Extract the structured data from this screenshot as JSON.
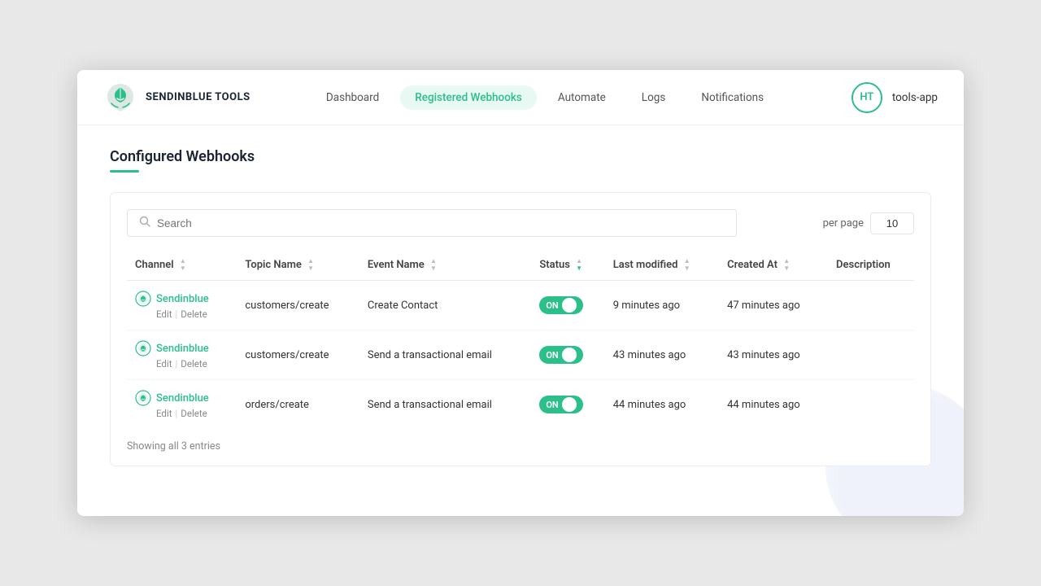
{
  "app": {
    "title": "SENDINBLUE TOOLS",
    "avatar_initials": "HT",
    "app_name": "tools-app"
  },
  "nav": {
    "items": [
      {
        "id": "dashboard",
        "label": "Dashboard",
        "active": false
      },
      {
        "id": "registered-webhooks",
        "label": "Registered Webhooks",
        "active": true
      },
      {
        "id": "automate",
        "label": "Automate",
        "active": false
      },
      {
        "id": "logs",
        "label": "Logs",
        "active": false
      },
      {
        "id": "notifications",
        "label": "Notifications",
        "active": false
      }
    ]
  },
  "page": {
    "title": "Configured Webhooks"
  },
  "search": {
    "placeholder": "Search",
    "value": ""
  },
  "pagination": {
    "per_page_label": "per page",
    "per_page_value": "10"
  },
  "table": {
    "columns": [
      {
        "id": "channel",
        "label": "Channel",
        "sortable": true,
        "sort_active": false
      },
      {
        "id": "topic_name",
        "label": "Topic Name",
        "sortable": true,
        "sort_active": false
      },
      {
        "id": "event_name",
        "label": "Event Name",
        "sortable": true,
        "sort_active": false
      },
      {
        "id": "status",
        "label": "Status",
        "sortable": true,
        "sort_active": true
      },
      {
        "id": "last_modified",
        "label": "Last modified",
        "sortable": true,
        "sort_active": false
      },
      {
        "id": "created_at",
        "label": "Created At",
        "sortable": true,
        "sort_active": false
      },
      {
        "id": "description",
        "label": "Description",
        "sortable": false,
        "sort_active": false
      }
    ],
    "rows": [
      {
        "channel": "Sendinblue",
        "topic_name": "customers/create",
        "event_name": "Create Contact",
        "status": "ON",
        "last_modified": "9 minutes ago",
        "created_at": "47 minutes ago",
        "description": ""
      },
      {
        "channel": "Sendinblue",
        "topic_name": "customers/create",
        "event_name": "Send a transactional email",
        "status": "ON",
        "last_modified": "43 minutes ago",
        "created_at": "43 minutes ago",
        "description": ""
      },
      {
        "channel": "Sendinblue",
        "topic_name": "orders/create",
        "event_name": "Send a transactional email",
        "status": "ON",
        "last_modified": "44 minutes ago",
        "created_at": "44 minutes ago",
        "description": ""
      }
    ],
    "footer": "Showing all 3 entries"
  },
  "actions": {
    "edit_label": "Edit",
    "delete_label": "Delete"
  }
}
